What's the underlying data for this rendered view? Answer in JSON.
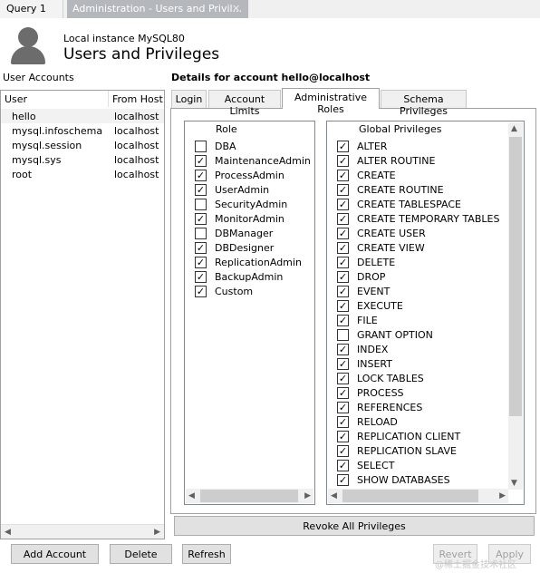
{
  "tabs": {
    "query": "Query 1",
    "admin": "Administration - Users and Privil..."
  },
  "header": {
    "instance": "Local instance MySQL80",
    "title": "Users and Privileges"
  },
  "user_accounts": {
    "label": "User Accounts",
    "columns": [
      "User",
      "From Host"
    ],
    "rows": [
      {
        "user": "hello",
        "host": "localhost"
      },
      {
        "user": "mysql.infoschema",
        "host": "localhost"
      },
      {
        "user": "mysql.session",
        "host": "localhost"
      },
      {
        "user": "mysql.sys",
        "host": "localhost"
      },
      {
        "user": "root",
        "host": "localhost"
      }
    ]
  },
  "details": {
    "title": "Details for account hello@localhost",
    "tabs": [
      "Login",
      "Account Limits",
      "Administrative Roles",
      "Schema Privileges"
    ],
    "roles_header": "Role",
    "roles": [
      {
        "name": "DBA",
        "checked": false
      },
      {
        "name": "MaintenanceAdmin",
        "checked": true
      },
      {
        "name": "ProcessAdmin",
        "checked": true
      },
      {
        "name": "UserAdmin",
        "checked": true
      },
      {
        "name": "SecurityAdmin",
        "checked": false
      },
      {
        "name": "MonitorAdmin",
        "checked": true
      },
      {
        "name": "DBManager",
        "checked": false
      },
      {
        "name": "DBDesigner",
        "checked": true
      },
      {
        "name": "ReplicationAdmin",
        "checked": true
      },
      {
        "name": "BackupAdmin",
        "checked": true
      },
      {
        "name": "Custom",
        "checked": true
      }
    ],
    "privileges_header": "Global Privileges",
    "privileges": [
      {
        "name": "ALTER",
        "checked": true
      },
      {
        "name": "ALTER ROUTINE",
        "checked": true
      },
      {
        "name": "CREATE",
        "checked": true
      },
      {
        "name": "CREATE ROUTINE",
        "checked": true
      },
      {
        "name": "CREATE TABLESPACE",
        "checked": true
      },
      {
        "name": "CREATE TEMPORARY TABLES",
        "checked": true
      },
      {
        "name": "CREATE USER",
        "checked": true
      },
      {
        "name": "CREATE VIEW",
        "checked": true
      },
      {
        "name": "DELETE",
        "checked": true
      },
      {
        "name": "DROP",
        "checked": true
      },
      {
        "name": "EVENT",
        "checked": true
      },
      {
        "name": "EXECUTE",
        "checked": true
      },
      {
        "name": "FILE",
        "checked": true
      },
      {
        "name": "GRANT OPTION",
        "checked": false
      },
      {
        "name": "INDEX",
        "checked": true
      },
      {
        "name": "INSERT",
        "checked": true
      },
      {
        "name": "LOCK TABLES",
        "checked": true
      },
      {
        "name": "PROCESS",
        "checked": true
      },
      {
        "name": "REFERENCES",
        "checked": true
      },
      {
        "name": "RELOAD",
        "checked": true
      },
      {
        "name": "REPLICATION CLIENT",
        "checked": true
      },
      {
        "name": "REPLICATION SLAVE",
        "checked": true
      },
      {
        "name": "SELECT",
        "checked": true
      },
      {
        "name": "SHOW DATABASES",
        "checked": true
      }
    ],
    "revoke_label": "Revoke All Privileges"
  },
  "buttons": {
    "add_account": "Add Account",
    "delete": "Delete",
    "refresh": "Refresh",
    "revert": "Revert",
    "apply": "Apply"
  },
  "watermark": "@稀土掘金技术社区"
}
